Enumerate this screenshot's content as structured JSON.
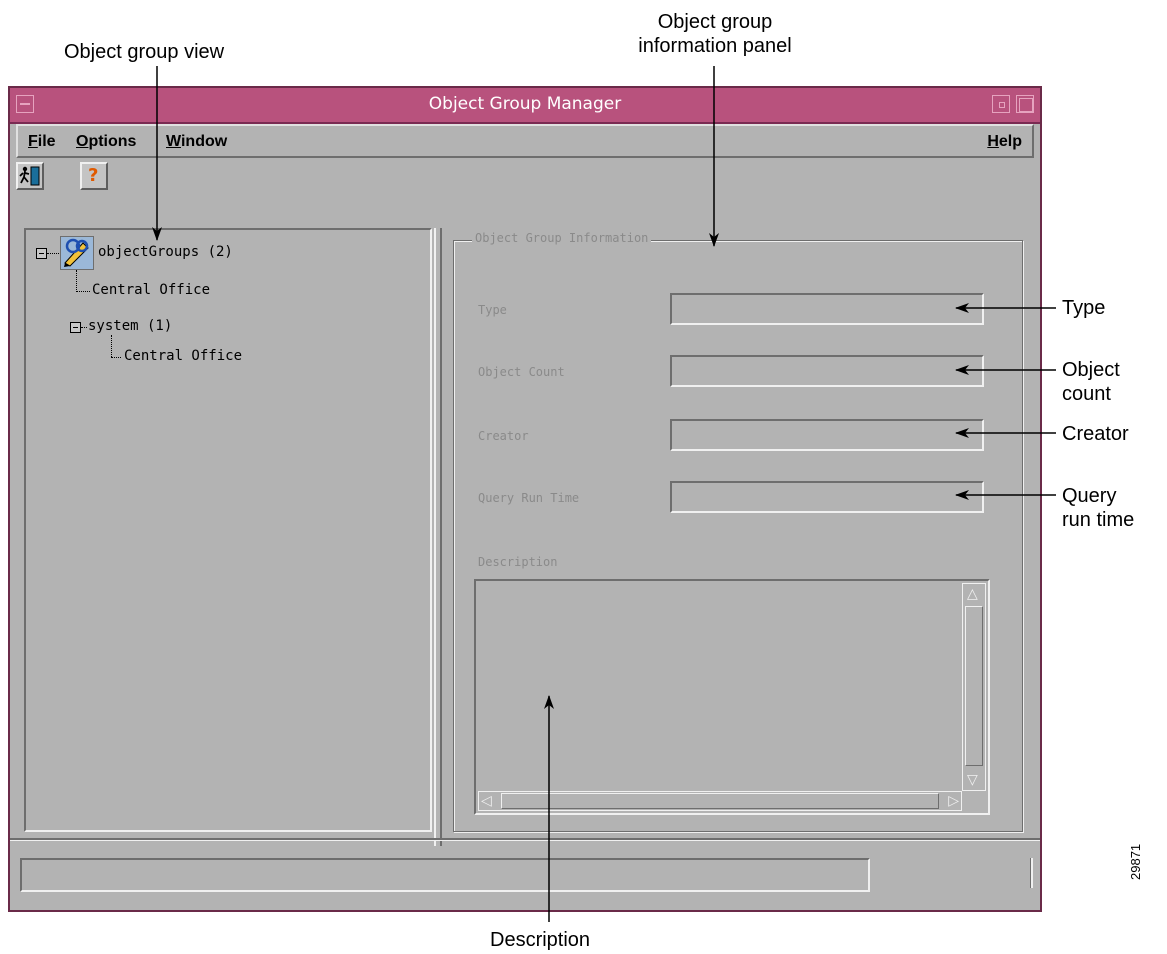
{
  "callouts": {
    "object_group_view": "Object group view",
    "info_panel_line1": "Object group",
    "info_panel_line2": "information panel",
    "type": "Type",
    "object_count_line1": "Object",
    "object_count_line2": "count",
    "creator": "Creator",
    "query_run_time_line1": "Query",
    "query_run_time_line2": "run time",
    "description": "Description"
  },
  "window": {
    "title": "Object Group Manager",
    "accent_color": "#b8527d"
  },
  "menubar": {
    "file": "File",
    "options": "Options",
    "window": "Window",
    "help": "Help"
  },
  "toolbar": {
    "exit_icon": "exit-door-icon",
    "help_icon": "help-question-icon",
    "help_glyph": "?"
  },
  "tree": {
    "root": "objectGroups (2)",
    "root_icon": "object-groups-icon",
    "child1": "Central Office",
    "child2": "system (1)",
    "grandchild1": "Central Office"
  },
  "info_panel": {
    "group_title": "Object Group Information",
    "type_label": "Type",
    "type_value": "",
    "object_count_label": "Object Count",
    "object_count_value": "",
    "creator_label": "Creator",
    "creator_value": "",
    "query_run_time_label": "Query Run Time",
    "query_run_time_value": "",
    "description_label": "Description",
    "description_value": ""
  },
  "status": {
    "text": ""
  },
  "figure_id": "29871"
}
